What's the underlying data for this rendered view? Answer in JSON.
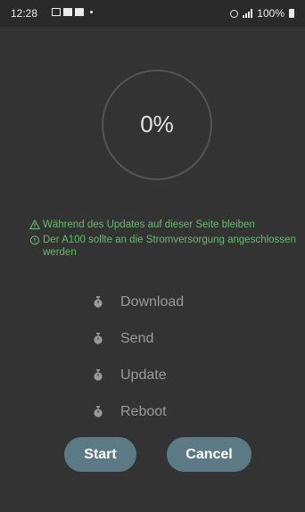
{
  "status_bar": {
    "time": "12:28",
    "battery_label": "100%"
  },
  "progress": {
    "label": "0%",
    "value": 0
  },
  "warnings": [
    {
      "icon": "warning-triangle-icon",
      "text": "Während des Updates auf dieser Seite bleiben"
    },
    {
      "icon": "info-circle-icon",
      "text": "Der A100 sollte an die Stromversorgung angeschlossen werden"
    }
  ],
  "steps": [
    {
      "icon": "timer-icon",
      "label": "Download"
    },
    {
      "icon": "timer-icon",
      "label": "Send"
    },
    {
      "icon": "timer-icon",
      "label": "Update"
    },
    {
      "icon": "timer-icon",
      "label": "Reboot"
    }
  ],
  "buttons": {
    "start": "Start",
    "cancel": "Cancel"
  },
  "colors": {
    "background": "#333333",
    "warning_text": "#66bb6a",
    "step_text": "#9a9a9a",
    "button": "#5b7a86"
  }
}
